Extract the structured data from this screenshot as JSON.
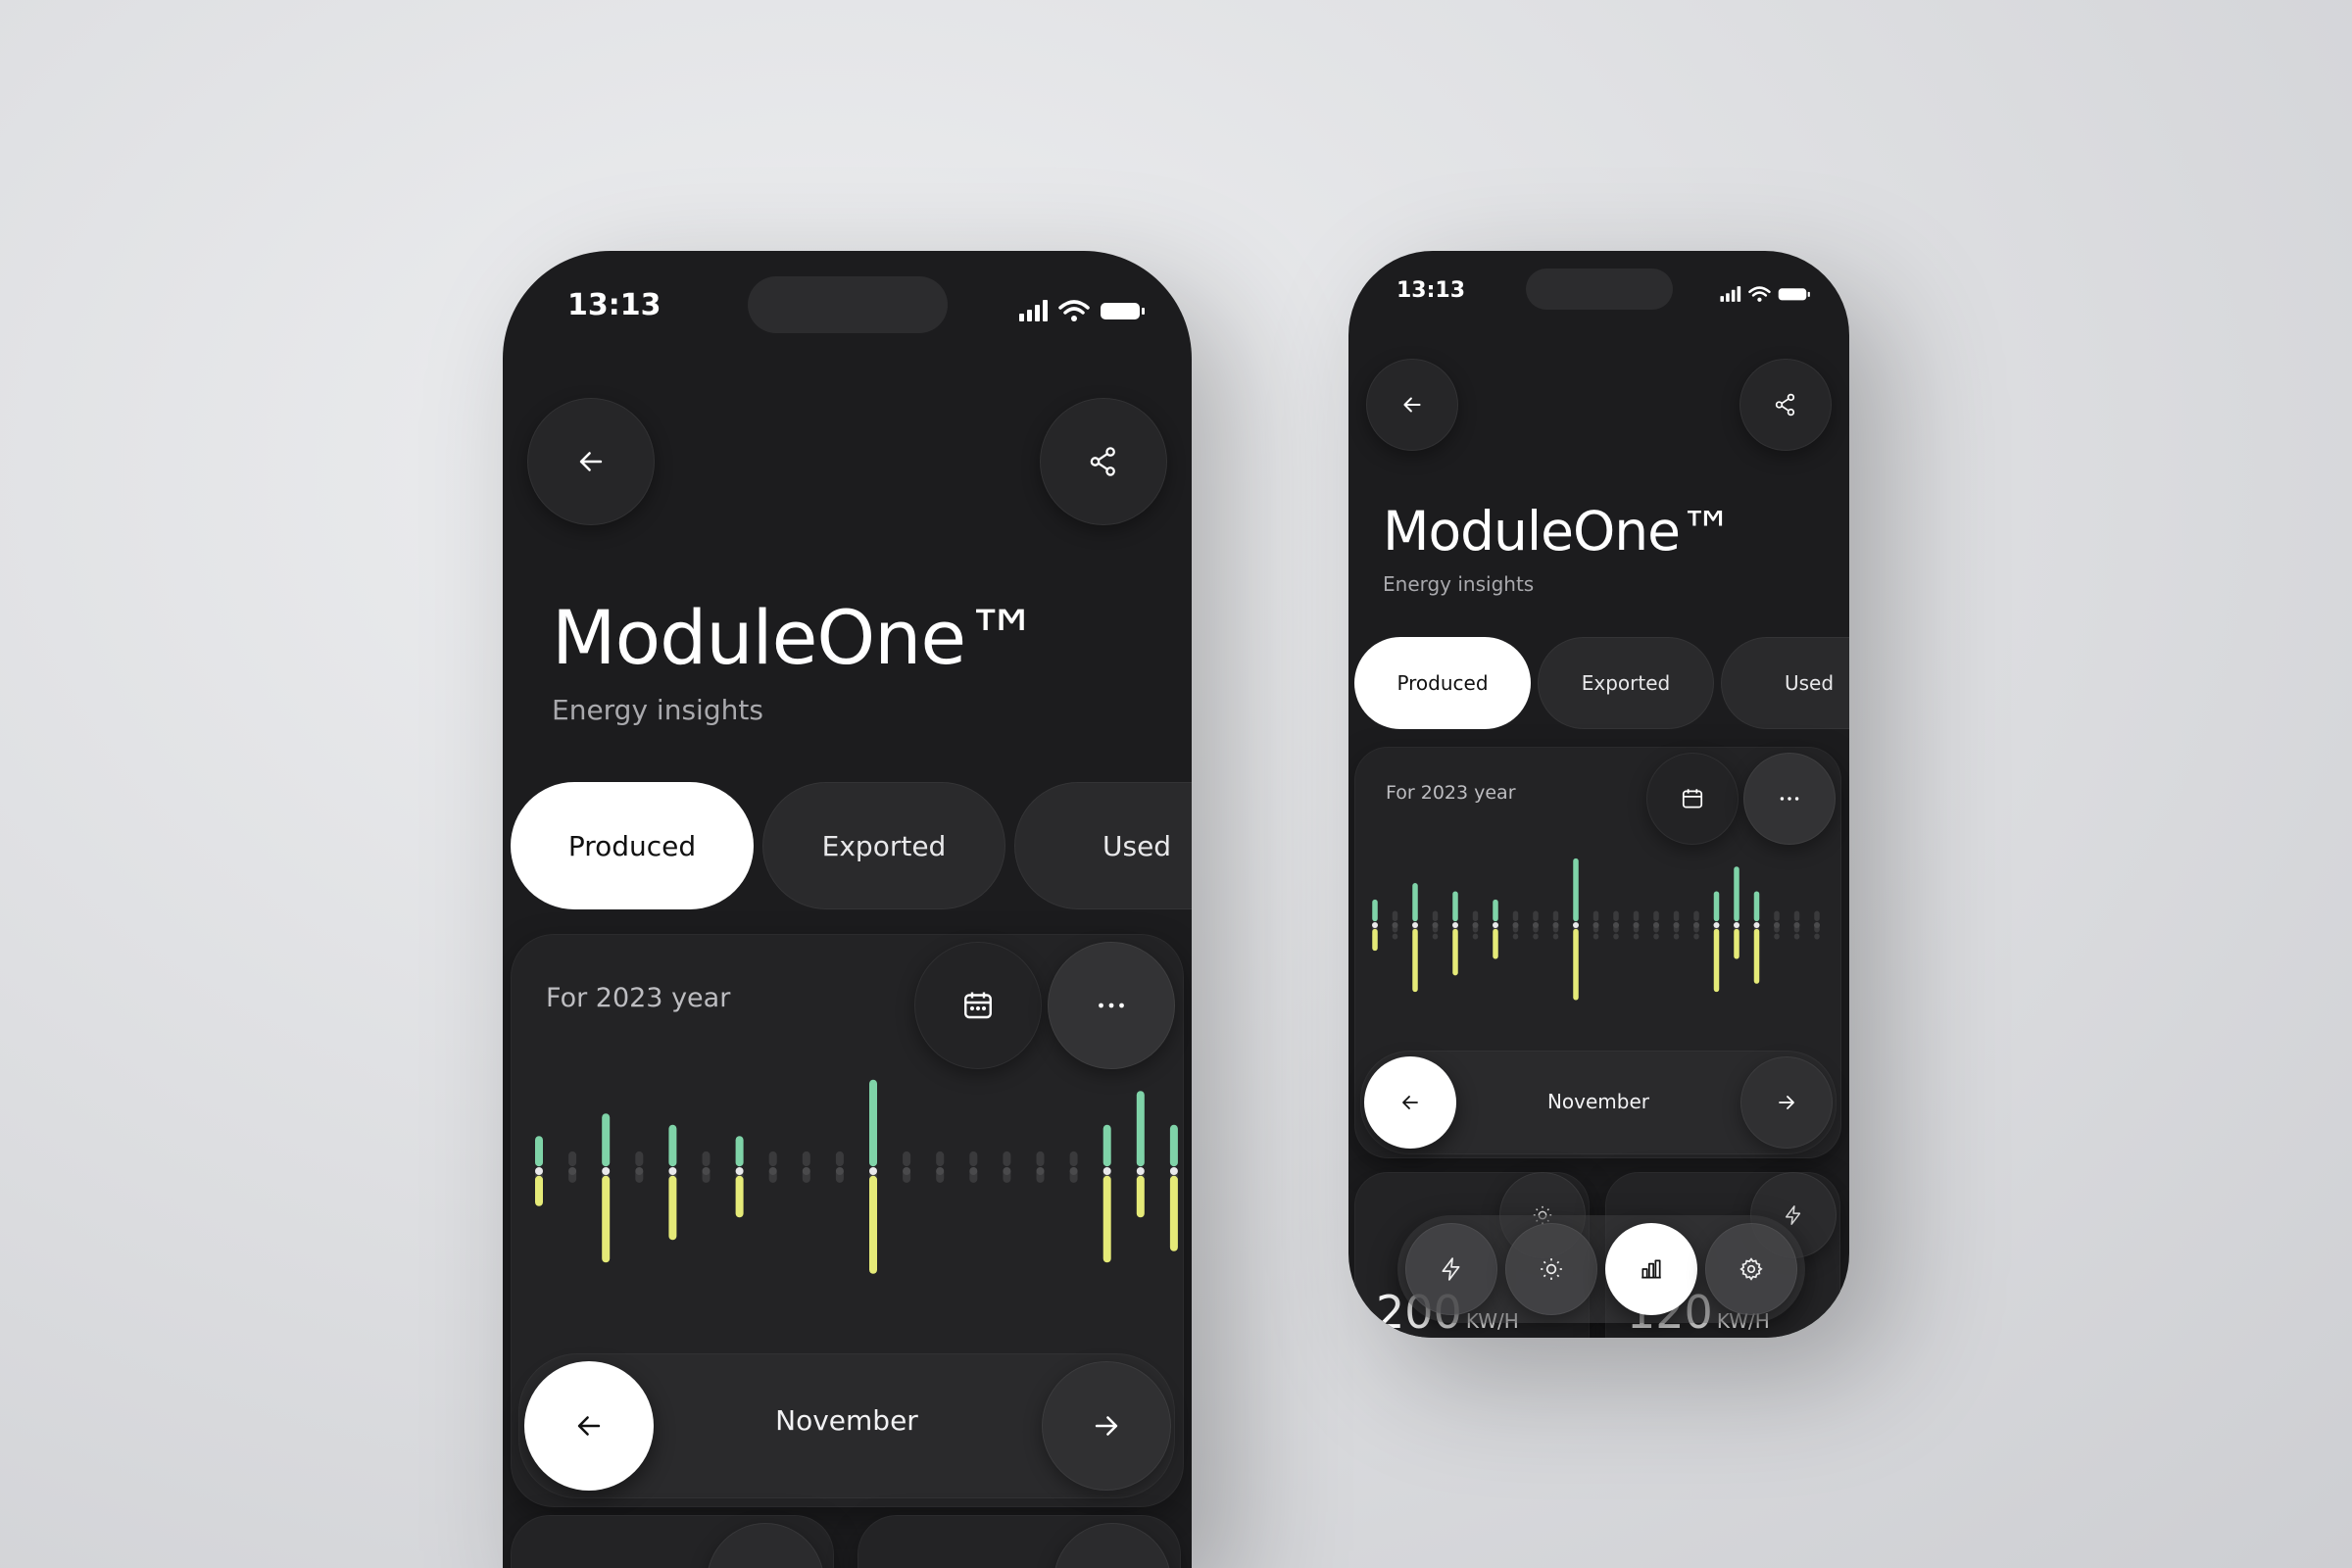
{
  "status": {
    "time": "13:13"
  },
  "app": {
    "title": "ModuleOne™",
    "subtitle": "Energy insights"
  },
  "tabs": [
    {
      "label": "Produced",
      "active": true
    },
    {
      "label": "Exported",
      "active": false
    },
    {
      "label": "Used",
      "active": false
    }
  ],
  "card": {
    "label": "For 2023 year",
    "month": "November"
  },
  "chart_data": {
    "type": "bar",
    "title": "",
    "series": [
      {
        "name": "",
        "color": "#7fd3a8",
        "values": [
          2,
          0,
          4,
          0,
          3,
          0,
          2,
          0,
          0,
          0,
          7,
          0,
          0,
          0,
          0,
          0,
          0,
          3,
          6,
          3,
          0,
          0,
          0
        ]
      },
      {
        "name": "",
        "color": "#e5ea78",
        "values": [
          2,
          0,
          7,
          0,
          5,
          0,
          3,
          0,
          0,
          0,
          8,
          0,
          0,
          0,
          0,
          0,
          0,
          7,
          3,
          6,
          0,
          0,
          0
        ]
      }
    ]
  },
  "stats": [
    {
      "value": "200",
      "unit": "KW/H"
    },
    {
      "value": "120",
      "unit": "KW/H"
    }
  ],
  "icons": {
    "back": "arrow-left-icon",
    "share": "share-icon",
    "calendar": "calendar-icon",
    "more": "more-icon",
    "next": "arrow-right-icon",
    "bolt": "lightning-icon",
    "sun": "sun-icon",
    "chart": "bar-chart-icon",
    "settings": "gear-icon"
  },
  "colors": {
    "background": "#1c1c1e",
    "produced": "#7fd3a8",
    "used": "#e5ea78",
    "active_tab": "#ffffff"
  }
}
